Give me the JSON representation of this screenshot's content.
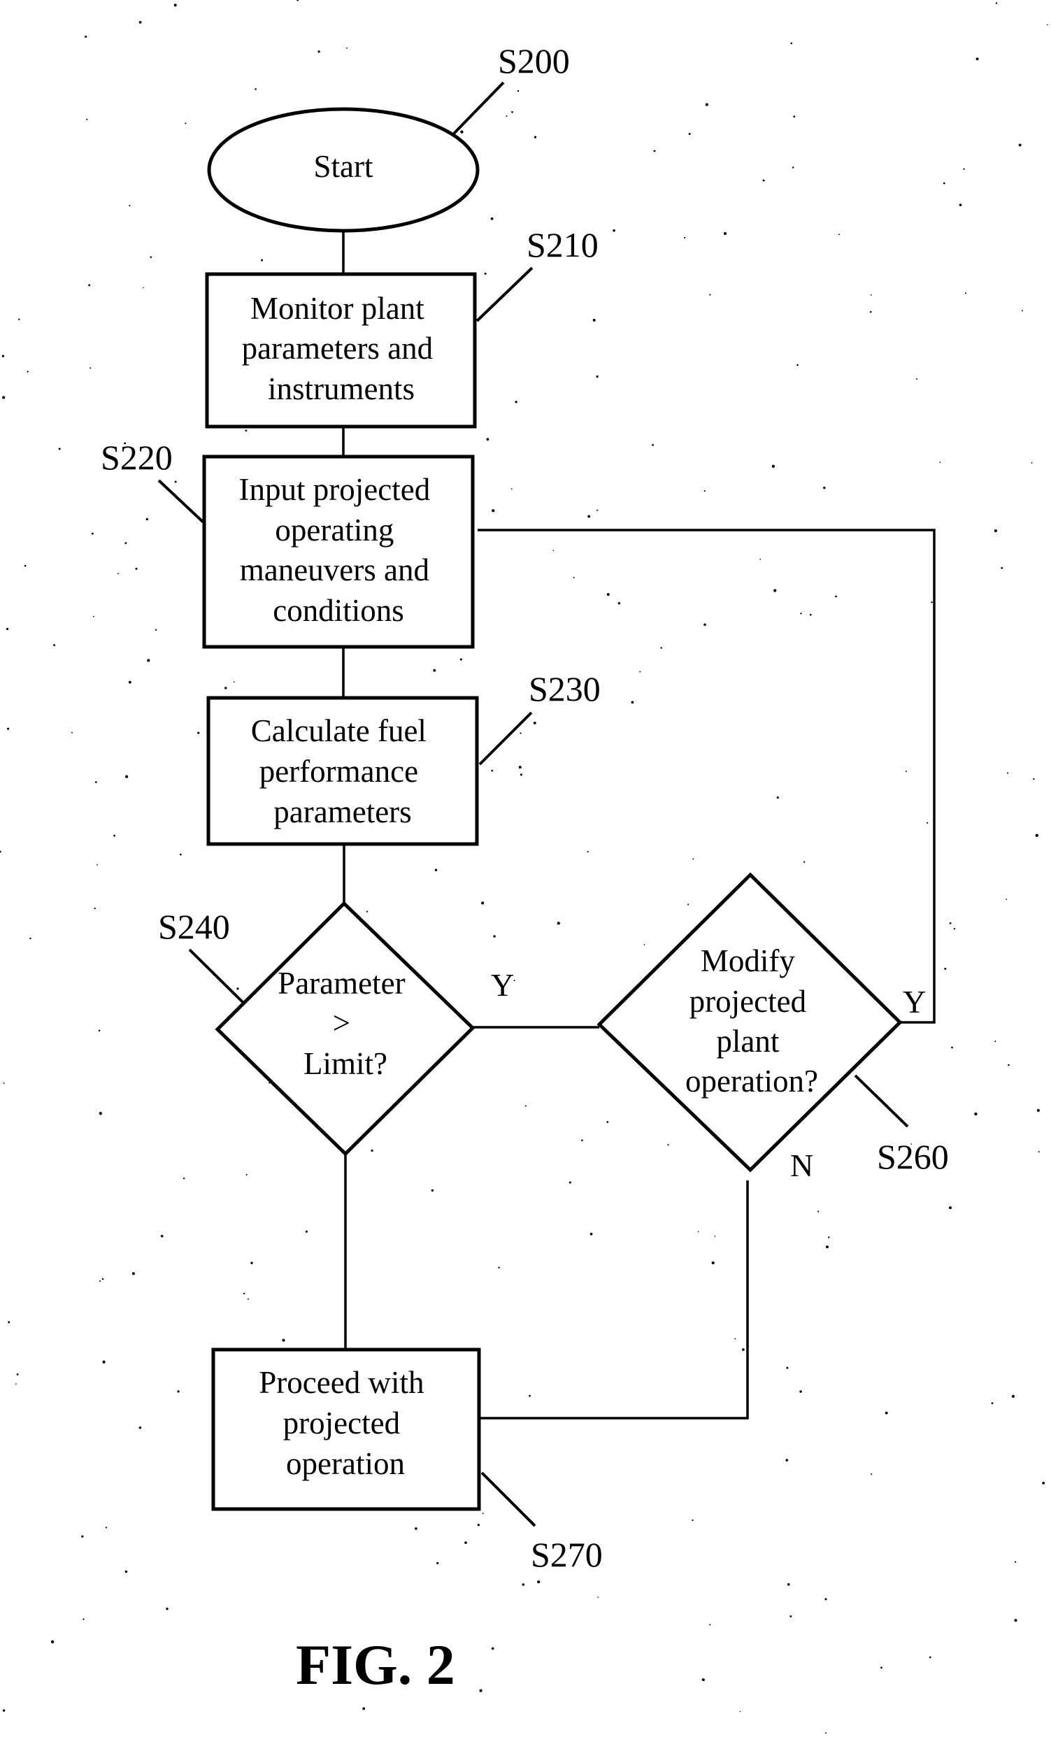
{
  "figure": {
    "title": "FIG. 2",
    "ink_color": "#000000",
    "background_color": "#ffffff"
  },
  "nodes": {
    "s200": {
      "id": "S200",
      "type": "terminal",
      "lines": [
        "Start"
      ]
    },
    "s210": {
      "id": "S210",
      "type": "process",
      "lines": [
        "Monitor plant",
        "parameters and",
        "instruments"
      ]
    },
    "s220": {
      "id": "S220",
      "type": "process",
      "lines": [
        "Input projected",
        "operating",
        "maneuvers and",
        "conditions"
      ]
    },
    "s230": {
      "id": "S230",
      "type": "process",
      "lines": [
        "Calculate fuel",
        "performance",
        "parameters"
      ]
    },
    "s240": {
      "id": "S240",
      "type": "decision",
      "lines": [
        "Parameter",
        ">",
        "Limit?"
      ]
    },
    "s260": {
      "id": "S260",
      "type": "decision",
      "lines": [
        "Modify",
        "projected",
        "plant",
        "operation?"
      ]
    },
    "s270": {
      "id": "S270",
      "type": "process",
      "lines": [
        "Proceed with",
        "projected",
        "operation"
      ]
    }
  },
  "edges": [
    {
      "from": "S200",
      "to": "S210",
      "label": ""
    },
    {
      "from": "S210",
      "to": "S220",
      "label": ""
    },
    {
      "from": "S220",
      "to": "S230",
      "label": ""
    },
    {
      "from": "S230",
      "to": "S240",
      "label": ""
    },
    {
      "from": "S240",
      "to": "S260",
      "label": "Y"
    },
    {
      "from": "S240",
      "to": "S270",
      "label": ""
    },
    {
      "from": "S260",
      "to": "S220",
      "label": "Y"
    },
    {
      "from": "S260",
      "to": "S270",
      "label": "N"
    }
  ],
  "branch_labels": {
    "s240_yes": "Y",
    "s260_yes": "Y",
    "s260_no": "N"
  }
}
